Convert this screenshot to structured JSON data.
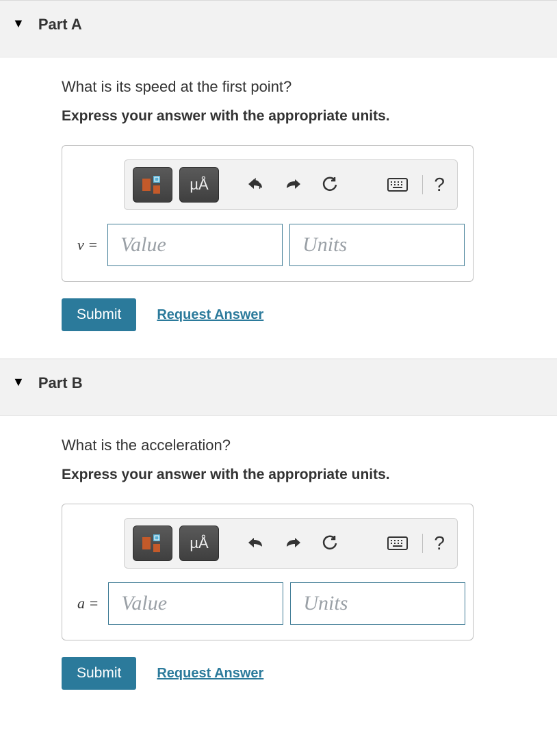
{
  "parts": [
    {
      "title": "Part A",
      "question": "What is its speed at the first point?",
      "instruction": "Express your answer with the appropriate units.",
      "toolbar": {
        "units_btn_label": "µÅ"
      },
      "variable_label": "v =",
      "value_placeholder": "Value",
      "units_placeholder": "Units",
      "submit_label": "Submit",
      "request_label": "Request Answer"
    },
    {
      "title": "Part B",
      "question": "What is the acceleration?",
      "instruction": "Express your answer with the appropriate units.",
      "toolbar": {
        "units_btn_label": "µÅ"
      },
      "variable_label": "a =",
      "value_placeholder": "Value",
      "units_placeholder": "Units",
      "submit_label": "Submit",
      "request_label": "Request Answer"
    }
  ]
}
